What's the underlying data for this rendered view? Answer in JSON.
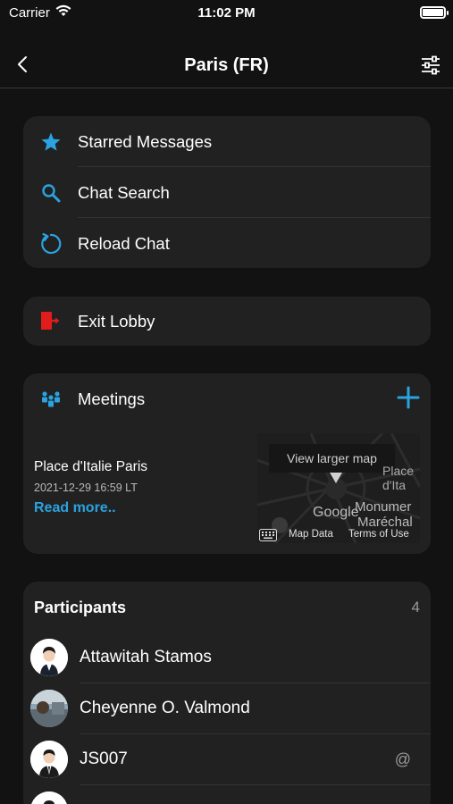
{
  "status_bar": {
    "carrier": "Carrier",
    "time": "11:02 PM"
  },
  "nav": {
    "title": "Paris (FR)"
  },
  "menu": {
    "items": [
      {
        "label": "Starred Messages",
        "icon": "star-icon"
      },
      {
        "label": "Chat Search",
        "icon": "search-icon"
      },
      {
        "label": "Reload Chat",
        "icon": "reload-icon"
      }
    ]
  },
  "exit": {
    "label": "Exit Lobby",
    "icon": "exit-icon"
  },
  "meetings": {
    "title": "Meetings",
    "item": {
      "name": "Place d'Italie Paris",
      "datetime": "2021-12-29 16:59 LT",
      "read_more": "Read more.."
    },
    "map": {
      "button": "View larger map",
      "label_1": "Place d'Ita",
      "label_google": "Google",
      "label_monument": "Monumer",
      "label_marechal": "Maréchal",
      "data": "Map Data",
      "terms": "Terms of Use"
    }
  },
  "participants": {
    "title": "Participants",
    "count": "4",
    "list": [
      {
        "name": "Attawitah Stamos",
        "mention": ""
      },
      {
        "name": "Cheyenne O. Valmond",
        "mention": ""
      },
      {
        "name": "JS007",
        "mention": "@"
      }
    ]
  },
  "colors": {
    "accent": "#2aa3e0",
    "card": "#212121",
    "background": "#121212",
    "exit_red": "#e01c1c"
  }
}
